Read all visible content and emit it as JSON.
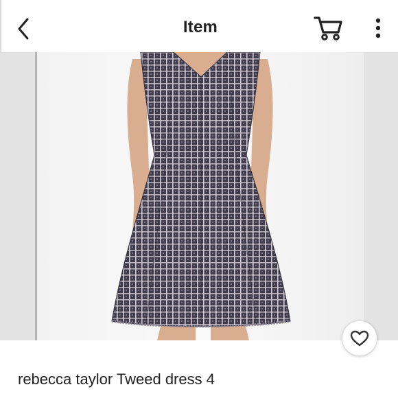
{
  "header": {
    "title": "Item",
    "back_icon": "chevron-left-icon",
    "cart_icon": "shopping-cart-icon",
    "more_icon": "more-vertical-icon"
  },
  "listing": {
    "title": "rebecca taylor Tweed dress 4",
    "like_icon": "heart-icon"
  },
  "colors": {
    "dress_base": "#3f3d4c",
    "dress_weave": "#c9c2cc",
    "skin": "#d8ad90"
  }
}
